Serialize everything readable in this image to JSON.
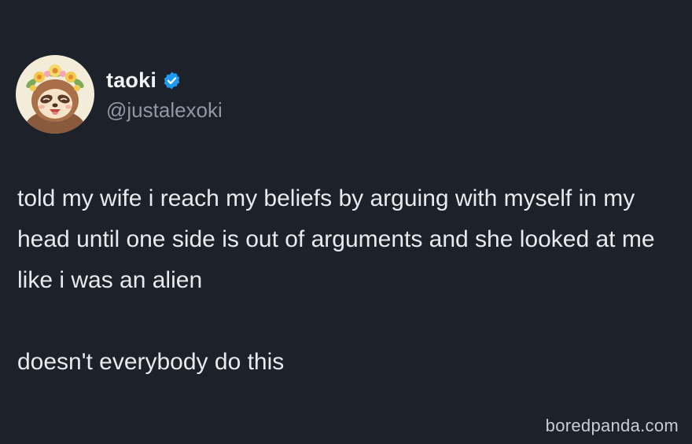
{
  "tweet": {
    "display_name": "taoki",
    "handle": "@justalexoki",
    "verified_icon": "verified-badge-icon",
    "paragraphs": [
      "told my wife i reach my beliefs by arguing with myself in my head until one side is out of arguments and she looked at me like i was an alien",
      "doesn't everybody do this"
    ]
  },
  "watermark": "boredpanda.com",
  "colors": {
    "background": "#1c212a",
    "text": "#e8eaed",
    "handle": "#8f98a3",
    "verified": "#1d9bf0"
  }
}
